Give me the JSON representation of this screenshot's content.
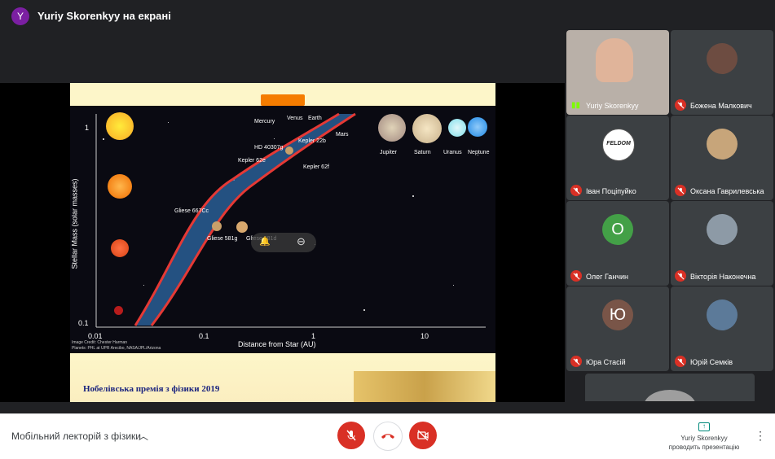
{
  "header": {
    "avatar_letter": "Y",
    "title": "Yuriy Skorenkyy на екрані"
  },
  "slide": {
    "y_axis_label": "Stellar Mass (solar masses)",
    "x_axis_label": "Distance from Star (AU)",
    "y_ticks": [
      "1",
      "0.1"
    ],
    "x_ticks": [
      "0.01",
      "0.1",
      "1",
      "10"
    ],
    "planet_labels": [
      "Mercury",
      "Venus",
      "Earth",
      "Mars",
      "HD 40307g",
      "Kepler 22b",
      "Kepler 62e",
      "Kepler 62f",
      "Gliese 667Cc",
      "Gliese 581g",
      "Gliese 581d"
    ],
    "solar_planets": [
      "Jupiter",
      "Saturn",
      "Uranus",
      "Neptune"
    ],
    "credit_line1": "Image Credit: Chester Harman",
    "credit_line2": "Planets: PHL at UPR Arecibo, NASA/JPL/Arizona",
    "footer_title": "Нобелівська премія з фізики 2019"
  },
  "participants": [
    {
      "name": "Yuriy Skorenkyy",
      "speaking": true
    },
    {
      "name": "Божена Малкович",
      "muted": true
    },
    {
      "name": "Іван Поціпуйко",
      "muted": true
    },
    {
      "name": "Оксана Гаврилевська",
      "muted": true
    },
    {
      "name": "Олег Ганчин",
      "muted": true,
      "letter": "О",
      "color": "#43a047"
    },
    {
      "name": "Вікторія Наконечна",
      "muted": true
    },
    {
      "name": "Юра Стасій",
      "muted": true,
      "letter": "Ю",
      "color": "#795548"
    },
    {
      "name": "Юрій Семків",
      "muted": true
    }
  ],
  "bottom": {
    "meeting_name": "Мобільний лекторій з фізики",
    "presenter_line1": "Yuriy Skorenkyy",
    "presenter_line2": "проводить презентацію"
  },
  "colors": {
    "end_call": "#d93025",
    "accent_green": "#43a047"
  }
}
